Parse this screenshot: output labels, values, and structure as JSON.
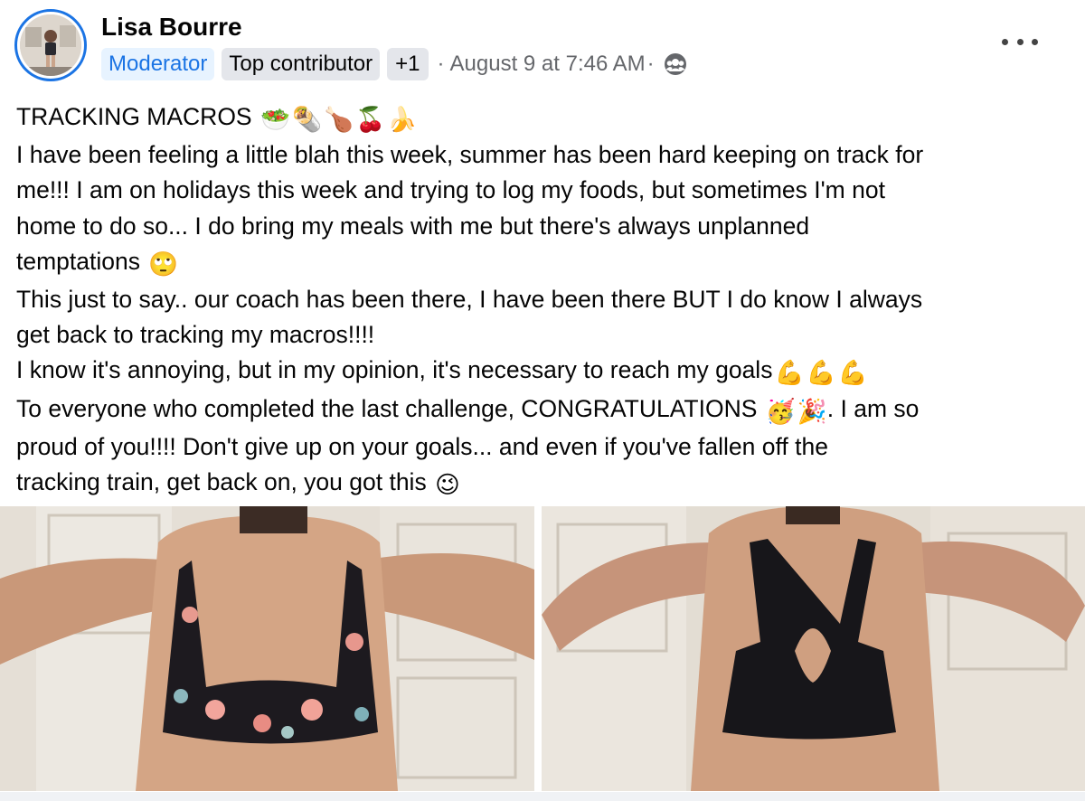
{
  "post": {
    "author": "Lisa Bourre",
    "badges": {
      "moderator": "Moderator",
      "top_contributor": "Top contributor",
      "extra": "+1"
    },
    "separator": "·",
    "date": "August 9 at 7:46 AM",
    "privacy_icon": "group-audience-icon",
    "more_icon": "more-options-icon",
    "lines": [
      "TRACKING MACROS",
      "I have been feeling a little blah this week, summer has been hard keeping on track for",
      "me!!!  I am on holidays this week and trying to log my foods, but sometimes I'm not",
      "home to do so... I do bring my meals with me but there's always unplanned",
      "temptations",
      "This just to say.. our coach has been there, I have been there BUT I do know I always",
      "get back to tracking my macros!!!!",
      "I know it's annoying, but in my opinion, it's necessary to reach my goals",
      "To everyone who completed the last challenge, CONGRATULATIONS",
      ". I am so",
      "proud of you!!!!  Don't give up on your goals... and even if you've fallen off the",
      "tracking train, get back on, you got this"
    ],
    "emojis": {
      "title": [
        "🥗",
        "🌯",
        "🍗",
        "🍒",
        "🍌"
      ],
      "temptations": "🙄",
      "goals": [
        "💪",
        "💪",
        "💪"
      ],
      "congrats": [
        "🥳",
        "🎉"
      ],
      "wink": "😉"
    }
  },
  "photos": [
    {
      "name": "before-photo",
      "top_color": "#1d1a1f",
      "pattern": "floral"
    },
    {
      "name": "after-photo",
      "top_color": "#17161a",
      "pattern": "solid"
    }
  ],
  "colors": {
    "accent": "#1b74e4",
    "badge_bg": "#e7f3ff",
    "meta_text": "#65676b"
  }
}
